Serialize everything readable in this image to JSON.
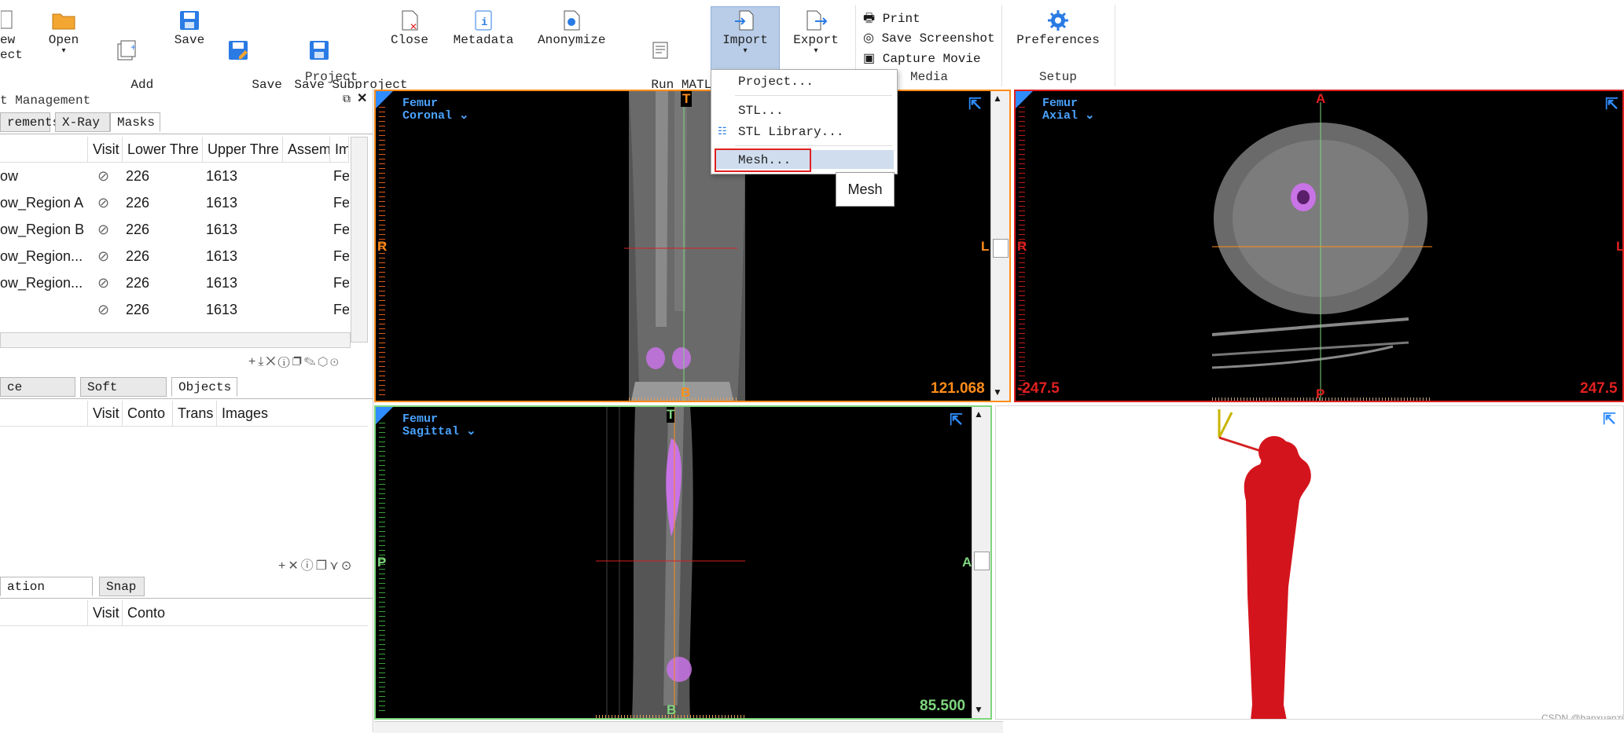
{
  "ribbon": {
    "buttons": {
      "new_project": "ew\nect",
      "open": "Open",
      "add_images": "Add\nImages",
      "save": "Save",
      "save_as": "Save\nAs",
      "save_subproject_as": "Save Subproject\nAs",
      "close": "Close",
      "metadata": "Metadata",
      "anonymize": "Anonymize",
      "run_matlab": "Run MATLAB\nScript",
      "import": "Import",
      "export": "Export",
      "print": "Print",
      "save_screenshot": "Save Screenshot",
      "capture_movie": "Capture Movie",
      "preferences": "Preferences"
    },
    "groups": {
      "project": "Project",
      "media": "Media",
      "setup": "Setup"
    },
    "accent_color": "#b9cde8"
  },
  "import_menu": {
    "items": [
      "Project...",
      "STL...",
      "STL Library...",
      "Mesh..."
    ],
    "highlighted": "Mesh...",
    "tooltip": "Mesh"
  },
  "mask_panel": {
    "title": "t Management",
    "tabs": [
      "rements",
      "X-Ray",
      "Masks"
    ],
    "active_tab": "Masks",
    "columns": [
      "",
      "Visit",
      "Lower Thre",
      "Upper Thre",
      "Assem",
      "Im"
    ],
    "rows": [
      {
        "name": "ow",
        "lower": "226",
        "upper": "1613",
        "img": "Fe"
      },
      {
        "name": "ow_Region A",
        "lower": "226",
        "upper": "1613",
        "img": "Fe"
      },
      {
        "name": "ow_Region B",
        "lower": "226",
        "upper": "1613",
        "img": "Fe"
      },
      {
        "name": "ow_Region...",
        "lower": "226",
        "upper": "1613",
        "img": "Fe"
      },
      {
        "name": "ow_Region...",
        "lower": "226",
        "upper": "1613",
        "img": "Fe"
      },
      {
        "name": "",
        "lower": "226",
        "upper": "1613",
        "img": "Fe"
      }
    ]
  },
  "objects_panel": {
    "tabs": [
      "ce Objects",
      "Soft tissue",
      "Objects"
    ],
    "active_tab": "Objects",
    "columns": [
      "",
      "Visit",
      "Conto",
      "Trans",
      "Images"
    ]
  },
  "analysis_panel": {
    "tabs": [
      "ation Objects",
      "Snap"
    ],
    "columns": [
      "",
      "Visit",
      "Conto"
    ]
  },
  "viewports": {
    "coronal": {
      "dataset": "Femur",
      "view": "Coronal",
      "top": "T",
      "bottom": "B",
      "left": "R",
      "right": "L",
      "value": "121.068"
    },
    "axial": {
      "dataset": "Femur",
      "view": "Axial",
      "top": "A",
      "bottom": "P",
      "left": "R",
      "right": "L",
      "value_left": "-247.5",
      "value_right": "247.5"
    },
    "sagittal": {
      "dataset": "Femur",
      "view": "Sagittal",
      "top": "T",
      "bottom": "B",
      "left": "P",
      "right": "A",
      "value": "85.500"
    },
    "model_3d": {}
  },
  "colors": {
    "coronal_border": "#ff8c1a",
    "axial_border": "#e02020",
    "sagittal_border": "#7ed67e",
    "mask_purple": "#c873e6",
    "bone_red": "#d4141c"
  },
  "watermark": "CSDN @hanxuanzi"
}
